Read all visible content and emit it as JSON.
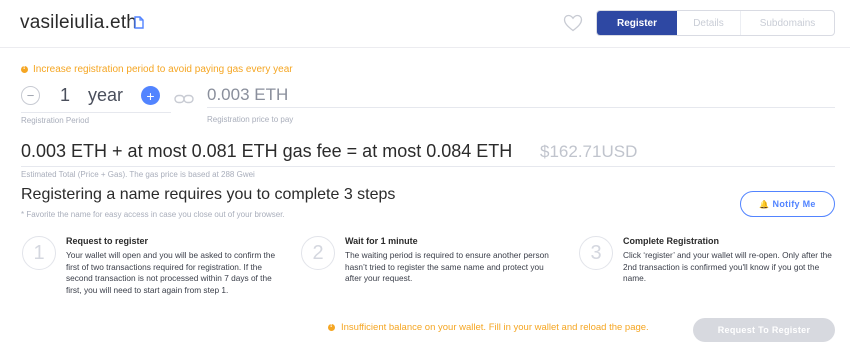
{
  "header": {
    "domain": "vasileiulia.eth",
    "tabs": [
      "Register",
      "Details",
      "Subdomains"
    ],
    "active_tab": "Register"
  },
  "registration": {
    "warning": "Increase registration period to avoid paying gas every year",
    "period_value": "1",
    "period_unit": "year",
    "period_label": "Registration Period",
    "price": "0.003 ETH",
    "price_label": "Registration price to pay"
  },
  "total": {
    "text": "0.003 ETH + at most 0.081 ETH gas fee = at most 0.084 ETH",
    "usd": "$162.71USD",
    "label": "Estimated Total (Price + Gas). The gas price is based at 288 Gwei"
  },
  "steps": {
    "title": "Registering a name requires you to complete 3 steps",
    "note": "* Favorite the name for easy access in case you close out of your browser.",
    "notify_label": "Notify Me",
    "items": [
      {
        "number": "1",
        "title": "Request to register",
        "body": "Your wallet will open and you will be asked to confirm the first of two transactions required for registration. If the second transaction is not processed within 7 days of the first, you will need to start again from step 1."
      },
      {
        "number": "2",
        "title": "Wait for 1 minute",
        "body": "The waiting period is required to ensure another person hasn’t tried to register the same name and protect you after your request."
      },
      {
        "number": "3",
        "title": "Complete Registration",
        "body": "Click ‘register’ and your wallet will re-open. Only after the 2nd transaction is confirmed you'll know if you got the name."
      }
    ]
  },
  "footer": {
    "insufficient": "Insufficient balance on your wallet. Fill in your wallet and reload the page.",
    "request_button": "Request To Register"
  },
  "colors": {
    "primary": "#2e48a3",
    "accent": "#5284ff",
    "warning": "#f5a623",
    "disabled": "#d7d9df"
  },
  "icons": [
    "copy-icon",
    "heart-icon",
    "minus-icon",
    "plus-icon",
    "link-icon",
    "bell-icon",
    "warning-icon"
  ]
}
